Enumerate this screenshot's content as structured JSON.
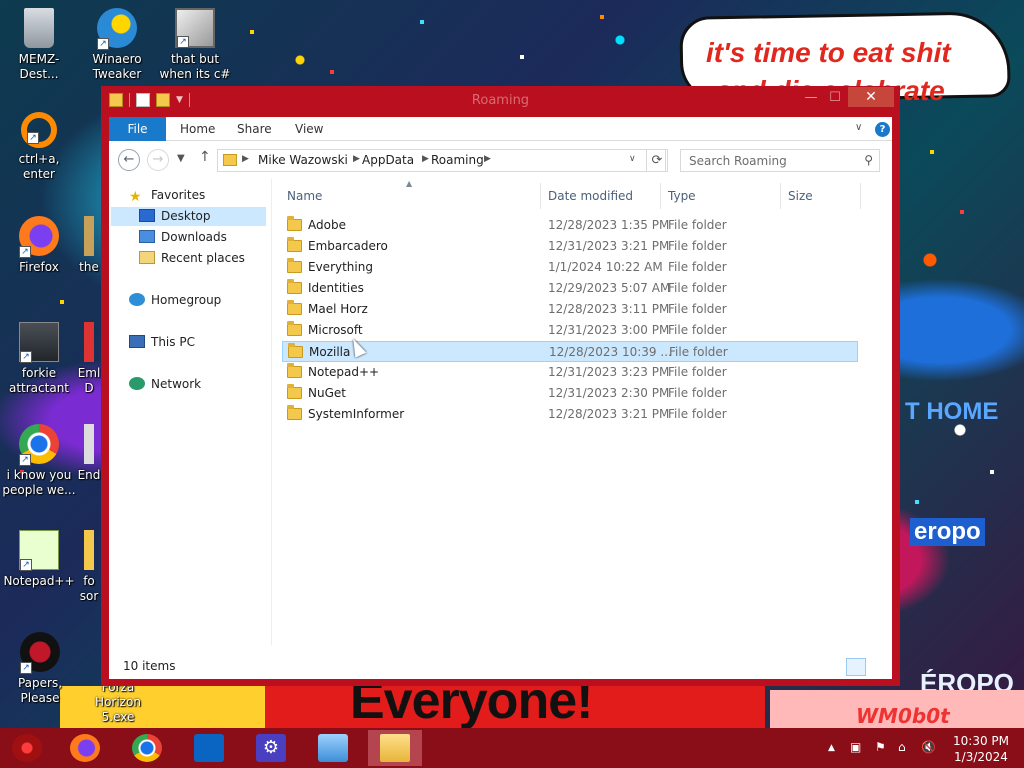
{
  "desktop": {
    "icons": [
      {
        "label": "MEMZ-Dest...",
        "icon": "recycle-bin-icon"
      },
      {
        "label": "Winaero Tweaker",
        "icon": "winaero-icon"
      },
      {
        "label": "that but when its c#",
        "icon": "stacked-windows-icon"
      },
      {
        "label": "ctrl+a, enter",
        "icon": "orange-ring-icon"
      },
      {
        "label": "Firefox",
        "icon": "firefox-icon"
      },
      {
        "label": "the",
        "icon": "partial-icon"
      },
      {
        "label": "forkie attractant",
        "icon": "program-icon"
      },
      {
        "label": "Eml D",
        "icon": "partial-icon"
      },
      {
        "label": "i know you people we...",
        "icon": "chrome-icon"
      },
      {
        "label": "End",
        "icon": "partial-icon"
      },
      {
        "label": "Notepad++",
        "icon": "notepadpp-icon"
      },
      {
        "label": "fo sor",
        "icon": "partial-icon"
      },
      {
        "label": "Papers, Please",
        "icon": "papers-please-icon"
      },
      {
        "label": "Forza Horizon 5.exe",
        "icon": "forza-icon"
      }
    ],
    "wallpaper": {
      "bubble_line1": "it's time to eat shit",
      "bubble_line2": "and die celebrate",
      "banner": "Everyone!",
      "watermark": "WM0b0t",
      "sign_home": "T HOME",
      "sign_aero": "eropo",
      "sign_aero2": "ÉROPO"
    }
  },
  "window": {
    "title": "Roaming",
    "minimize": "—",
    "maximize": "☐",
    "close": "✕",
    "ribbon_tabs": [
      "File",
      "Home",
      "Share",
      "View"
    ],
    "help": "?",
    "address": [
      "Mike Wazowski",
      "AppData",
      "Roaming"
    ],
    "search_placeholder": "Search Roaming",
    "nav_pane": {
      "favorites": "Favorites",
      "desktop": "Desktop",
      "downloads": "Downloads",
      "recent": "Recent places",
      "homegroup": "Homegroup",
      "this_pc": "This PC",
      "network": "Network"
    },
    "columns": [
      "Name",
      "Date modified",
      "Type",
      "Size"
    ],
    "files": [
      {
        "name": "Adobe",
        "date": "12/28/2023 1:35 PM",
        "type": "File folder"
      },
      {
        "name": "Embarcadero",
        "date": "12/31/2023 3:21 PM",
        "type": "File folder"
      },
      {
        "name": "Everything",
        "date": "1/1/2024 10:22 AM",
        "type": "File folder"
      },
      {
        "name": "Identities",
        "date": "12/29/2023 5:07 AM",
        "type": "File folder"
      },
      {
        "name": "Mael Horz",
        "date": "12/28/2023 3:11 PM",
        "type": "File folder"
      },
      {
        "name": "Microsoft",
        "date": "12/31/2023 3:00 PM",
        "type": "File folder"
      },
      {
        "name": "Mozilla",
        "date": "12/28/2023 10:39 ...",
        "type": "File folder",
        "selected": true
      },
      {
        "name": "Notepad++",
        "date": "12/31/2023 3:23 PM",
        "type": "File folder"
      },
      {
        "name": "NuGet",
        "date": "12/31/2023 2:30 PM",
        "type": "File folder"
      },
      {
        "name": "SystemInformer",
        "date": "12/28/2023 3:21 PM",
        "type": "File folder"
      }
    ],
    "status": "10 items"
  },
  "taskbar": {
    "apps": [
      "start-icon",
      "firefox-icon",
      "chrome-icon",
      "outlook-icon",
      "settings-icon",
      "control-panel-icon",
      "file-explorer-icon"
    ],
    "time": "10:30 PM",
    "date": "1/3/2024"
  },
  "colors": {
    "window_frame": "#b90f1f",
    "ribbon_file": "#1979ca",
    "selection": "#cce8ff",
    "taskbar": "#8a0e18"
  }
}
